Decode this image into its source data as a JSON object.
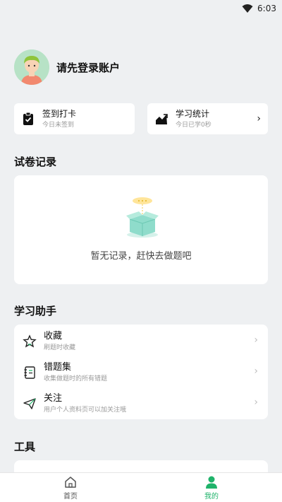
{
  "status": {
    "time": "6:03"
  },
  "profile": {
    "login_prompt": "请先登录账户"
  },
  "cards": {
    "checkin": {
      "title": "签到打卡",
      "subtitle": "今日未签到"
    },
    "stats": {
      "title": "学习统计",
      "subtitle": "今日已学0秒",
      "chevron": "›"
    }
  },
  "records": {
    "title": "试卷记录",
    "empty_text": "暂无记录，赶快去做题吧"
  },
  "helper": {
    "title": "学习助手",
    "items": [
      {
        "label": "收藏",
        "desc": "刷题时收藏",
        "icon": "star-icon"
      },
      {
        "label": "错题集",
        "desc": "收集做题时的所有错题",
        "icon": "notebook-icon"
      },
      {
        "label": "关注",
        "desc": "用户个人资料页可以加关注哦",
        "icon": "paper-plane-icon"
      }
    ],
    "chevron": "›"
  },
  "tools": {
    "title": "工具"
  },
  "tabbar": {
    "home": "首页",
    "mine": "我的"
  },
  "colors": {
    "accent": "#1fb36a",
    "background": "#eef0f2"
  }
}
